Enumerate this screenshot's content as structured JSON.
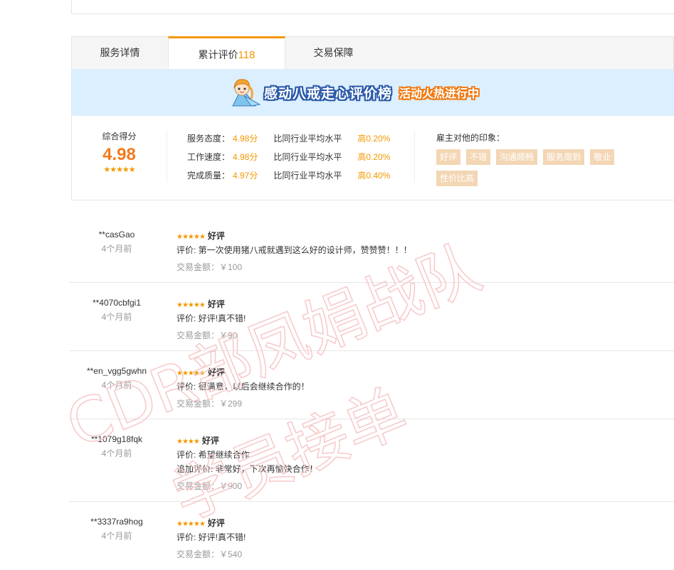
{
  "tabs": [
    {
      "label": "服务详情"
    },
    {
      "label": "累计评价",
      "count": "118"
    },
    {
      "label": "交易保障"
    }
  ],
  "banner": {
    "main": "感动八戒走心评价榜",
    "sub": "活动火热进行中"
  },
  "summary": {
    "score_label": "综合得分",
    "score": "4.98",
    "stars": "★★★★★",
    "metrics": [
      {
        "label": "服务态度：",
        "value": "4.98",
        "unit": "分",
        "compare": "比同行业平均水平",
        "pct": "高0.20%"
      },
      {
        "label": "工作速度：",
        "value": "4.98",
        "unit": "分",
        "compare": "比同行业平均水平",
        "pct": "高0.20%"
      },
      {
        "label": "完成质量：",
        "value": "4.97",
        "unit": "分",
        "compare": "比同行业平均水平",
        "pct": "高0.40%"
      }
    ],
    "impression_title": "雇主对他的印象：",
    "tags": [
      "好评",
      "不错",
      "沟通顺畅",
      "服务周到",
      "敬业",
      "性价比高"
    ]
  },
  "reviews": [
    {
      "user": "**casGao",
      "time": "4个月前",
      "stars": "★★★★★",
      "rating": "好评",
      "lines": [
        "评价: 第一次使用猪八戒就遇到这么好的设计师，赞赞赞！！！"
      ],
      "amount": "交易金额：￥100"
    },
    {
      "user": "**4070cbfgi1",
      "time": "4个月前",
      "stars": "★★★★★",
      "rating": "好评",
      "lines": [
        "评价: 好评!真不错!"
      ],
      "amount": "交易金额：￥90"
    },
    {
      "user": "**en_vgg5gwhn",
      "time": "4个月前",
      "stars": "★★★★★",
      "rating": "好评",
      "lines": [
        "评价: 很满意，以后会继续合作的！"
      ],
      "amount": "交易金额：￥299"
    },
    {
      "user": "**1079g18fqk",
      "time": "4个月前",
      "stars": "★★★★",
      "rating": "好评",
      "lines": [
        "评价: 希望继续合作",
        "追加评价: 非常好，下次再愉快合作！"
      ],
      "amount": "交易金额：￥900"
    },
    {
      "user": "**3337ra9hog",
      "time": "4个月前",
      "stars": "★★★★★",
      "rating": "好评",
      "lines": [
        "评价: 好评!真不错!"
      ],
      "amount": "交易金额：￥540"
    }
  ],
  "watermark": {
    "line1": "CDR部凤娟战队",
    "line2": "学员接单",
    "color": "#f7c9c9"
  }
}
